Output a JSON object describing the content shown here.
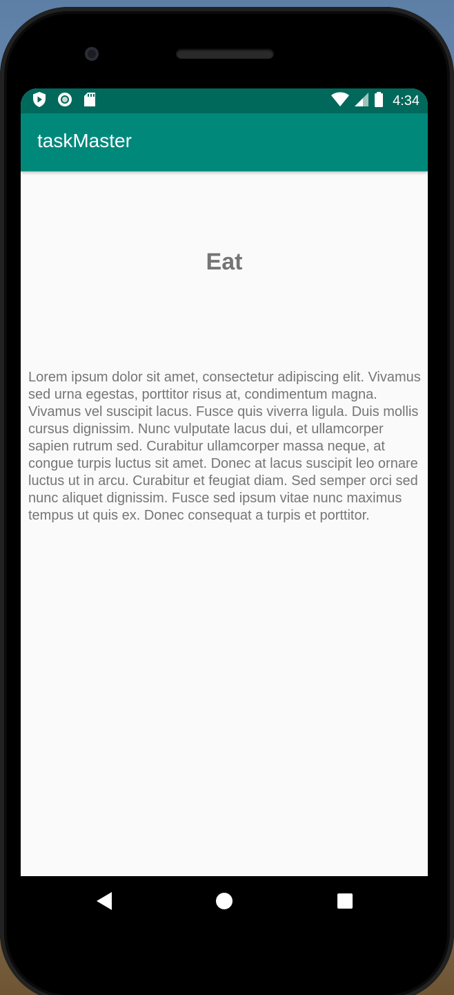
{
  "status_bar": {
    "time": "4:34",
    "left_icons": [
      "shield-play-icon",
      "circle-sync-icon",
      "sd-card-icon"
    ],
    "right_icons": [
      "wifi-icon",
      "cell-signal-icon",
      "battery-icon"
    ]
  },
  "app_bar": {
    "title": "taskMaster"
  },
  "task": {
    "title": "Eat",
    "description": "Lorem ipsum dolor sit amet, consectetur adipiscing elit. Vivamus sed urna egestas, porttitor risus at, condimentum magna. Vivamus vel suscipit lacus. Fusce quis viverra ligula. Duis mollis cursus dignissim. Nunc vulputate lacus dui, et ullamcorper sapien rutrum sed. Curabitur ullamcorper massa neque, at congue turpis luctus sit amet. Donec at lacus suscipit leo ornare luctus ut in arcu. Curabitur et feugiat diam. Sed semper orci sed nunc aliquet dignissim. Fusce sed ipsum vitae nunc maximus tempus ut quis ex. Donec consequat a turpis et porttitor."
  },
  "nav_bar": {
    "buttons": [
      "back-icon",
      "home-icon",
      "recents-icon"
    ]
  },
  "colors": {
    "status_bar": "#00695c",
    "app_bar": "#00897b",
    "text_gray": "#757575",
    "screen_bg": "#fafafa"
  }
}
